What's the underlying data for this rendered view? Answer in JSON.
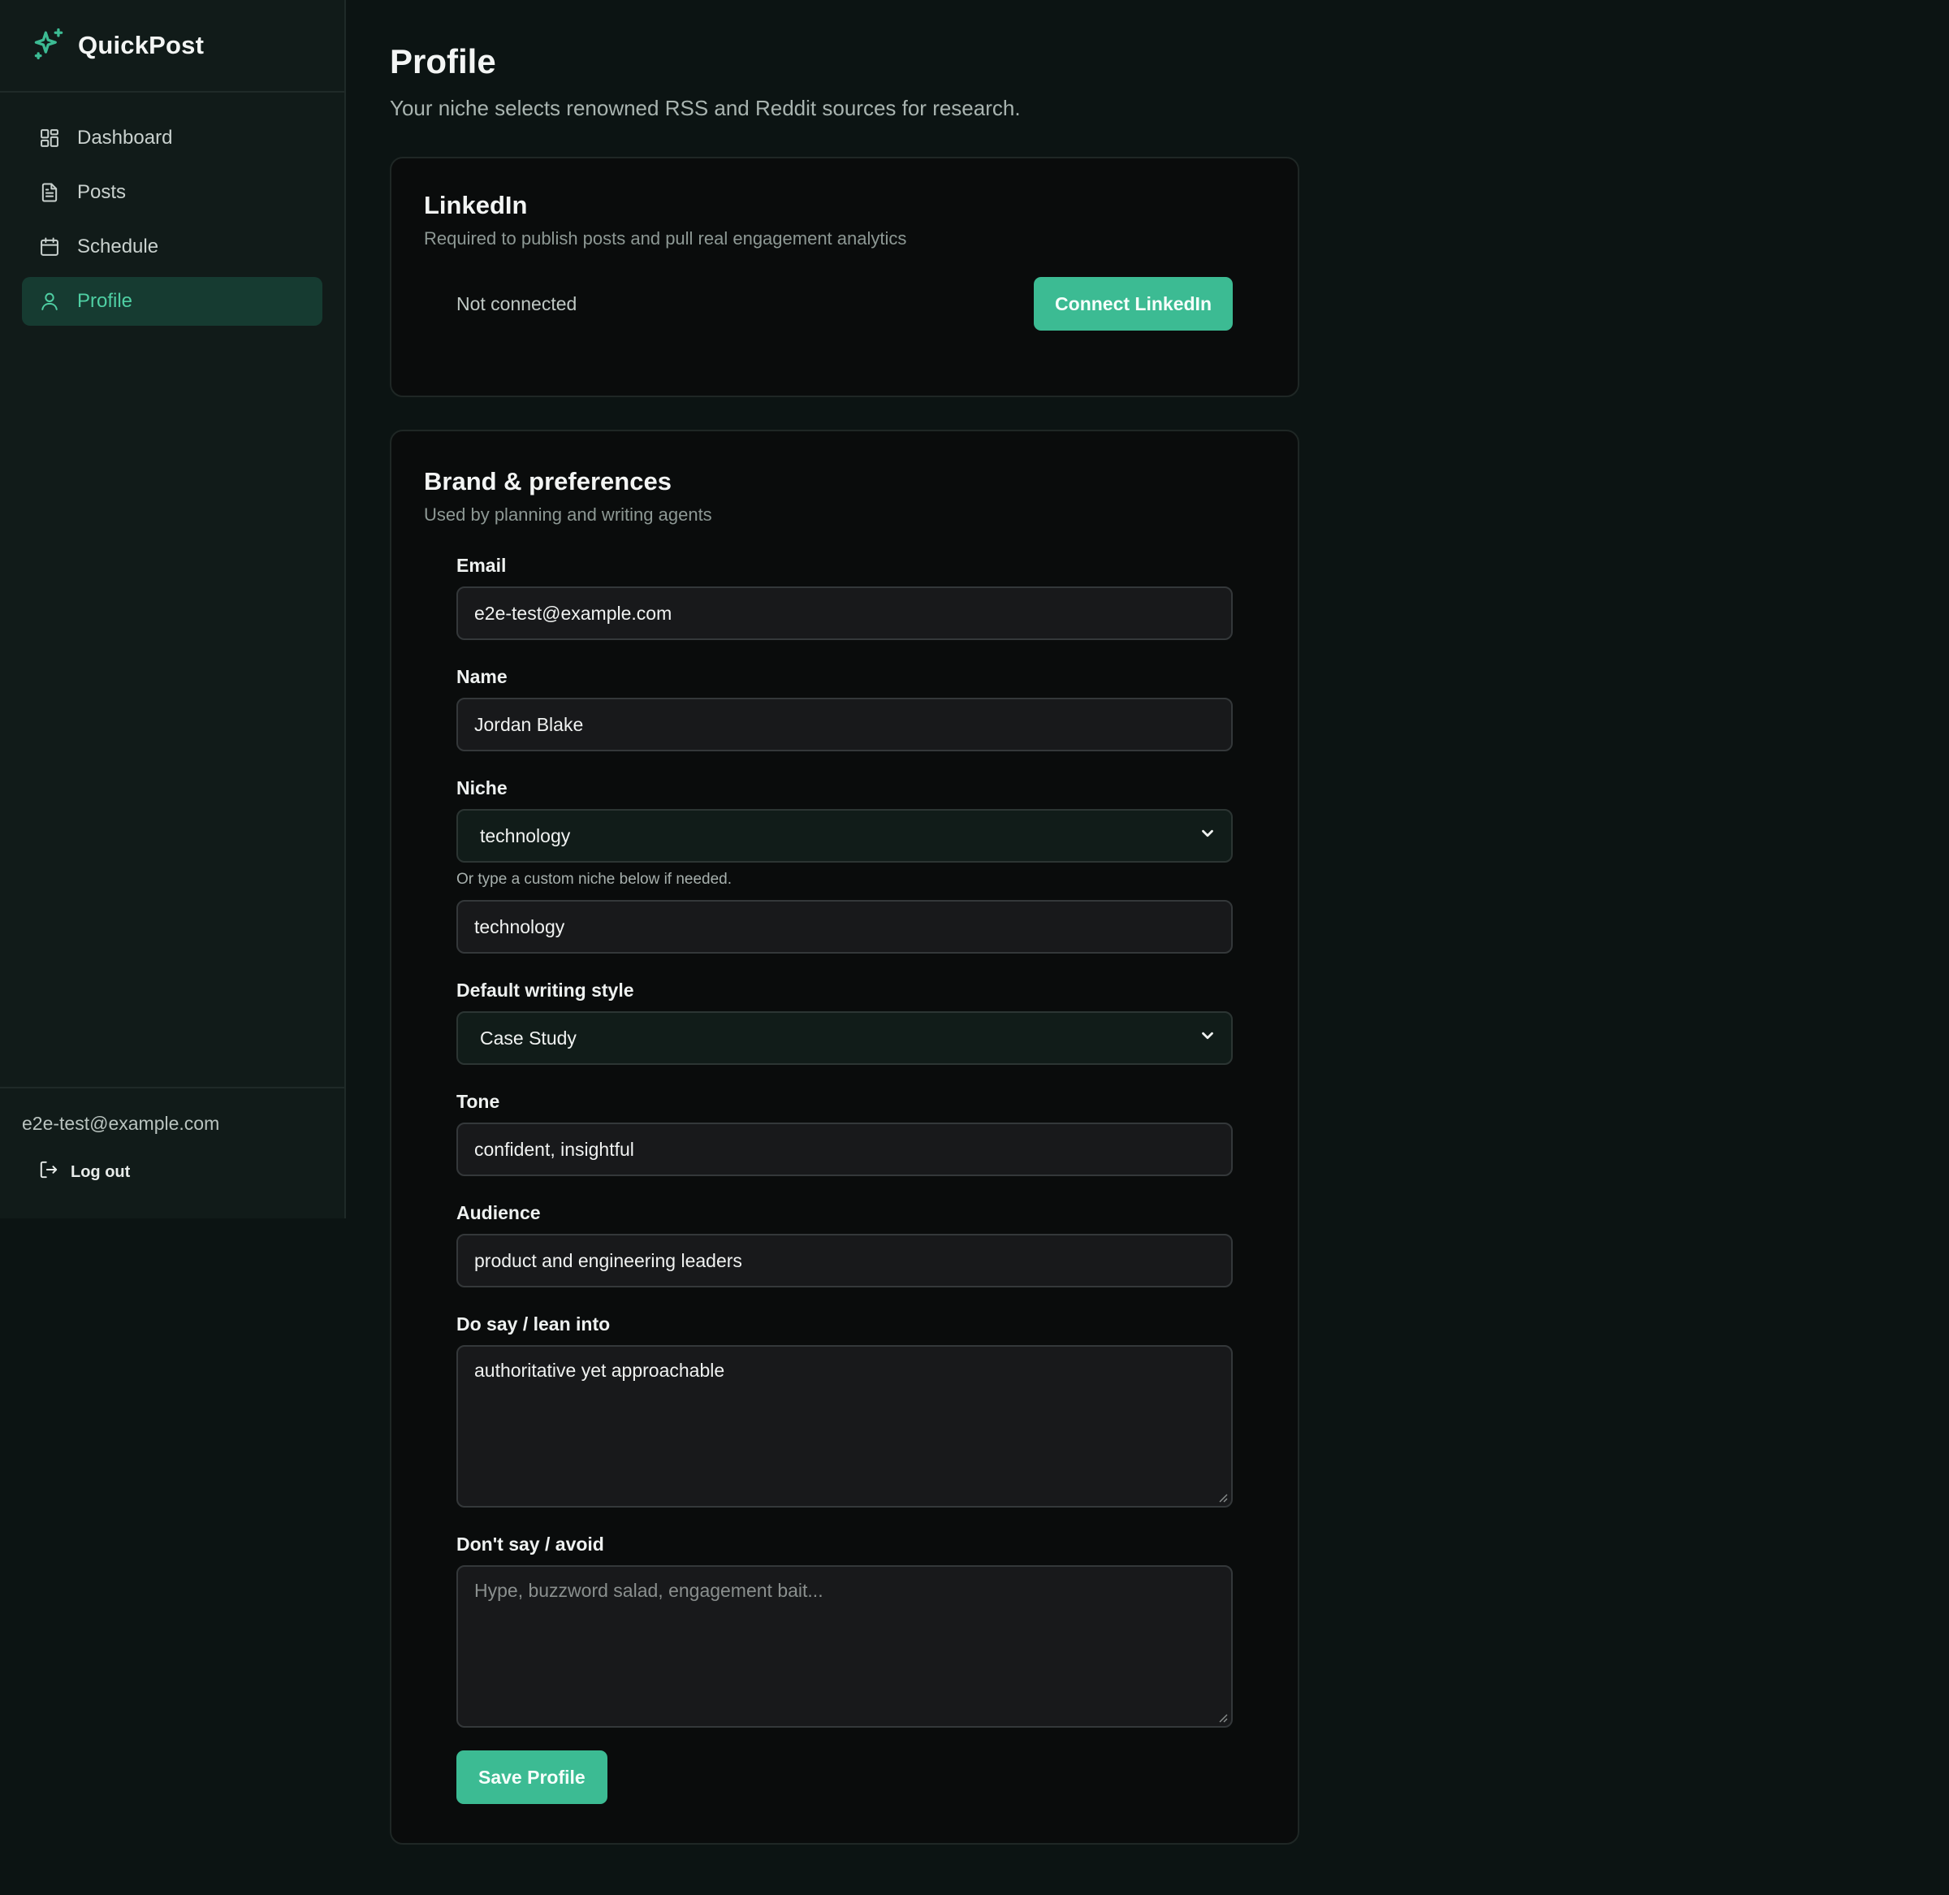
{
  "app": {
    "name": "QuickPost",
    "accent_color": "#3cbb93",
    "logo_icon": "sparkles-icon"
  },
  "sidebar": {
    "items": [
      {
        "label": "Dashboard",
        "icon": "dashboard-icon",
        "active": false
      },
      {
        "label": "Posts",
        "icon": "document-icon",
        "active": false
      },
      {
        "label": "Schedule",
        "icon": "calendar-icon",
        "active": false
      },
      {
        "label": "Profile",
        "icon": "user-icon",
        "active": true
      }
    ],
    "user_email": "e2e-test@example.com",
    "logout_label": "Log out"
  },
  "page": {
    "title": "Profile",
    "subtitle": "Your niche selects renowned RSS and Reddit sources for research."
  },
  "linkedin": {
    "title": "LinkedIn",
    "description": "Required to publish posts and pull real engagement analytics",
    "status": "Not connected",
    "connect_label": "Connect LinkedIn"
  },
  "brand": {
    "title": "Brand & preferences",
    "description": "Used by planning and writing agents",
    "fields": {
      "email": {
        "label": "Email",
        "value": "e2e-test@example.com"
      },
      "name": {
        "label": "Name",
        "value": "Jordan Blake"
      },
      "niche": {
        "label": "Niche",
        "selected": "technology",
        "hint": "Or type a custom niche below if needed.",
        "custom_value": "technology"
      },
      "writing_style": {
        "label": "Default writing style",
        "selected": "Case Study"
      },
      "tone": {
        "label": "Tone",
        "value": "confident, insightful"
      },
      "audience": {
        "label": "Audience",
        "value": "product and engineering leaders"
      },
      "do_say": {
        "label": "Do say / lean into",
        "value": "authoritative yet approachable"
      },
      "dont_say": {
        "label": "Don't say / avoid",
        "value": "",
        "placeholder": "Hype, buzzword salad, engagement bait..."
      }
    },
    "save_label": "Save Profile"
  }
}
